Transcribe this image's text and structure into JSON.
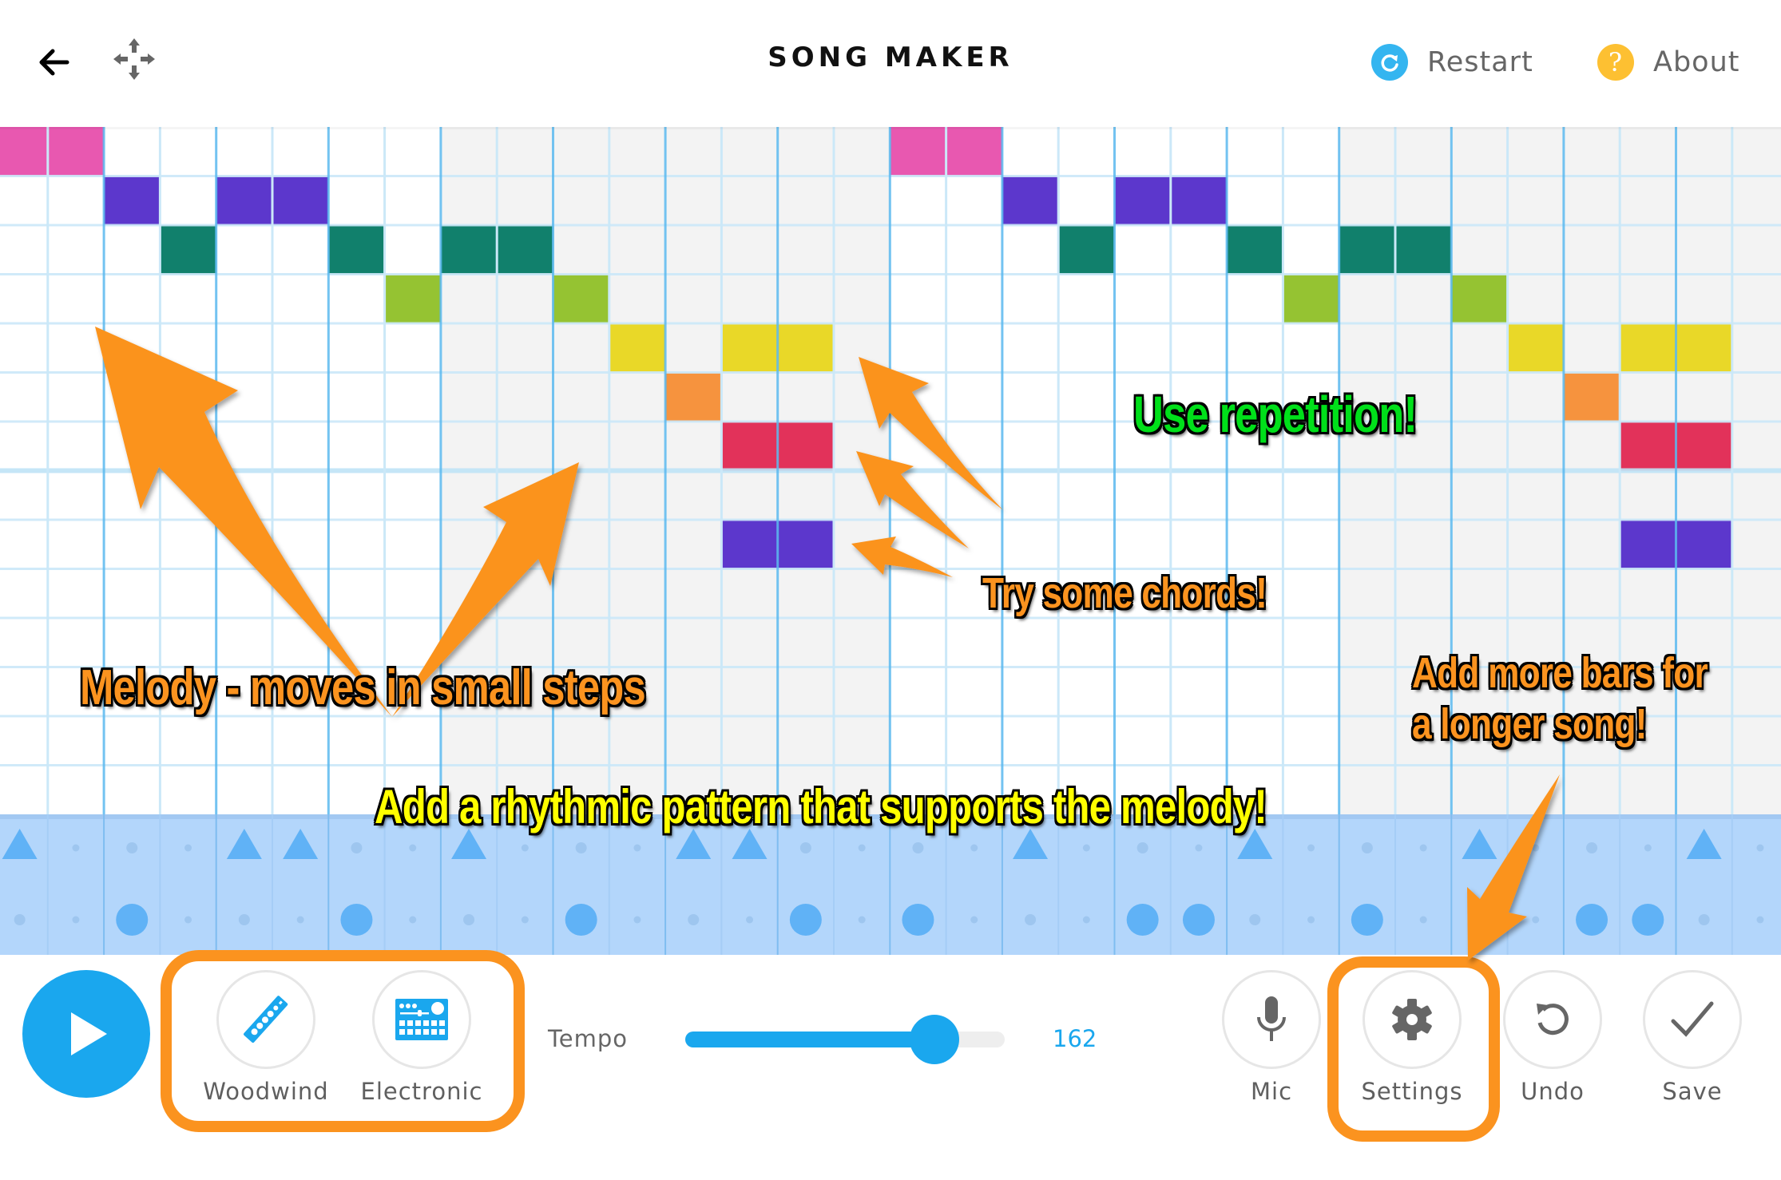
{
  "header": {
    "title": "SONG MAKER",
    "back_icon": "arrow-left-icon",
    "move_icon": "move-arrows-icon",
    "restart": {
      "label": "Restart",
      "icon": "restart-icon",
      "color": "#34b5f0"
    },
    "about": {
      "label": "About",
      "icon": "question-icon",
      "color": "#fdc032"
    }
  },
  "grid": {
    "columns": 32,
    "rows": 14,
    "beats_per_bar_columns": 8,
    "octave_boundary_row": 7,
    "shaded_bars": [
      1,
      3
    ],
    "colors": {
      "line_minor": "#cbe8f8",
      "line_major": "#5ab9ee",
      "octave_line": "#bfe3f6",
      "shade": "#f3f3f3"
    },
    "notes": [
      {
        "row": 0,
        "cols": [
          0,
          1,
          16,
          17
        ],
        "color": "#e858b0"
      },
      {
        "row": 1,
        "cols": [
          2,
          4,
          5,
          18,
          20,
          21
        ],
        "color": "#5c37cc"
      },
      {
        "row": 2,
        "cols": [
          3,
          6,
          8,
          9,
          19,
          22,
          24,
          25
        ],
        "color": "#11806c"
      },
      {
        "row": 3,
        "cols": [
          7,
          10,
          23,
          26
        ],
        "color": "#95c332"
      },
      {
        "row": 4,
        "cols": [
          11,
          13,
          14,
          27,
          29,
          30
        ],
        "color": "#e9d828"
      },
      {
        "row": 5,
        "cols": [
          12,
          28
        ],
        "color": "#f6933e"
      },
      {
        "row": 6,
        "cols": [
          13,
          14,
          29,
          30
        ],
        "color": "#e2325a"
      },
      {
        "row": 8,
        "cols": [
          13,
          14,
          29,
          30
        ],
        "color": "#5c37cc"
      }
    ]
  },
  "percussion": {
    "background": "#b3d6fb",
    "active_color": "#60b2f6",
    "empty_color": "#96bfea",
    "triangles": [
      0,
      4,
      5,
      8,
      12,
      13,
      18,
      22,
      26,
      30
    ],
    "circles": [
      2,
      6,
      10,
      14,
      16,
      20,
      21,
      24,
      28,
      29
    ]
  },
  "controls": {
    "play": {
      "icon": "play-icon",
      "color": "#1aa7ee"
    },
    "instruments": [
      {
        "label": "Woodwind",
        "icon": "flute-icon"
      },
      {
        "label": "Electronic",
        "icon": "drum-machine-icon"
      }
    ],
    "tempo": {
      "label": "Tempo",
      "value": "162",
      "fill_fraction": 0.78
    },
    "tools": [
      {
        "label": "Mic",
        "icon": "microphone-icon"
      },
      {
        "label": "Settings",
        "icon": "gear-icon"
      },
      {
        "label": "Undo",
        "icon": "undo-icon"
      },
      {
        "label": "Save",
        "icon": "checkmark-icon"
      }
    ]
  },
  "annotations": {
    "accent": "#fb931f",
    "melody": "Melody - moves in small steps",
    "repetition": "Use repetition!",
    "chords": "Try some chords!",
    "rhythm": "Add a rhythmic pattern that supports the melody!",
    "more_bars_line1": "Add more bars for",
    "more_bars_line2": "a longer song!",
    "colors": {
      "orange": "#fb931f",
      "green": "#00e01a",
      "yellow": "#ffff00"
    }
  }
}
